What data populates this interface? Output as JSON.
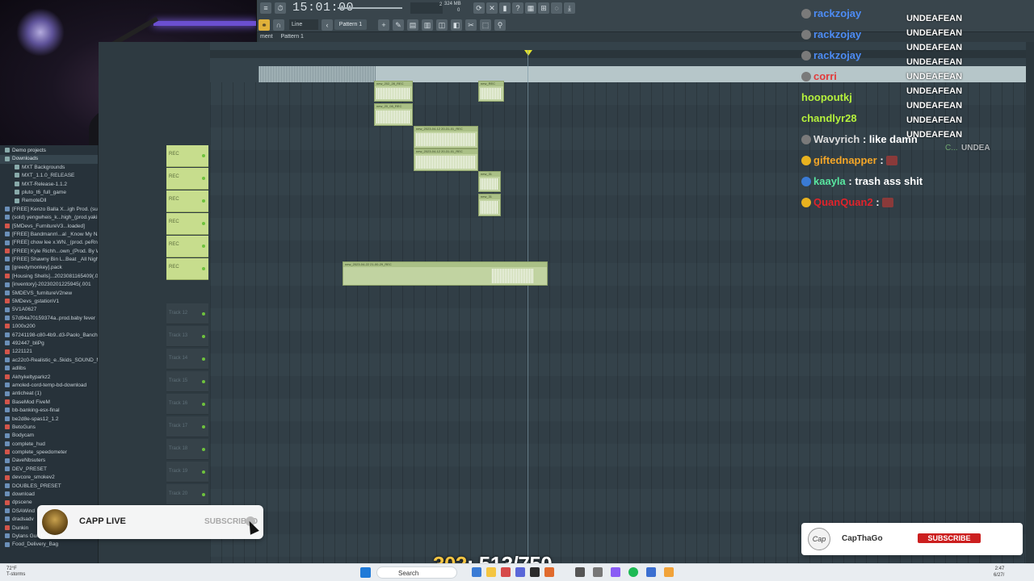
{
  "toolbar": {
    "time": "15:01:00",
    "snap": "Line",
    "pattern": "Pattern 1",
    "cpu": "2",
    "mem": "324 MB",
    "zero": "0"
  },
  "subtabs": {
    "left": "ment",
    "pattern": "Pattern 1"
  },
  "browser": {
    "rows": [
      {
        "label": "Demo projects",
        "type": "folder"
      },
      {
        "label": "Downloads",
        "type": "folder",
        "selected": true
      },
      {
        "label": "MXT Backgrounds",
        "type": "subfolder"
      },
      {
        "label": "MXT_1.1.0_RELEASE",
        "type": "subfolder"
      },
      {
        "label": "MXT-Release-1.1.2",
        "type": "subfolder"
      },
      {
        "label": "pluto_t6_full_game",
        "type": "subfolder"
      },
      {
        "label": "RemoteDll",
        "type": "subfolder"
      },
      {
        "label": "[FREE] Kenzo Balla X...igh Prod. (suave)",
        "type": "file"
      },
      {
        "label": "(sold) yengwheis_k...high_(prod.yakira)",
        "type": "file"
      },
      {
        "label": "[5MDevs_FurnitureV3...loaded]",
        "type": "file"
      },
      {
        "label": "[FREE] Bandmanrri...al _Know My Name",
        "type": "file"
      },
      {
        "label": "[FREE] chow lee x.WN._(prod. peRnd)",
        "type": "file"
      },
      {
        "label": "[FREE] Kyle Richh...own_(Prod. By War)",
        "type": "file"
      },
      {
        "label": "[FREE] Shawny Bin L..Beat _All Night_",
        "type": "file"
      },
      {
        "label": "[greedymonkey].pack",
        "type": "file"
      },
      {
        "label": "[Housing Shells]...2023081165409(.001",
        "type": "file"
      },
      {
        "label": "[inventory]-20230201225945(.001",
        "type": "file"
      },
      {
        "label": "5MDEVS_furnitureV2new",
        "type": "file"
      },
      {
        "label": "5MDevs_gstationV1",
        "type": "file"
      },
      {
        "label": "5V1A0627",
        "type": "file"
      },
      {
        "label": "57d94a70159374a..prod.baby fever",
        "type": "file"
      },
      {
        "label": "1000x200",
        "type": "file"
      },
      {
        "label": "67241198-c80-4b9..d3-Paolo_Banchero",
        "type": "file"
      },
      {
        "label": "492447_bliPg",
        "type": "file"
      },
      {
        "label": "1221121",
        "type": "file"
      },
      {
        "label": "ac22c0-Realistic_e..5kids_SOUND_MOD",
        "type": "file"
      },
      {
        "label": "adlibs",
        "type": "file"
      },
      {
        "label": "Akhykeltyparkz2",
        "type": "file"
      },
      {
        "label": "amoled-cord-temp-bd-download",
        "type": "file"
      },
      {
        "label": "anticheat (1)",
        "type": "file"
      },
      {
        "label": "BaseMod FiveM",
        "type": "file"
      },
      {
        "label": "bb-banking-esx-final",
        "type": "file"
      },
      {
        "label": "be2d8e-spas12_1.2",
        "type": "file"
      },
      {
        "label": "BetoGuns",
        "type": "file"
      },
      {
        "label": "Bodycam",
        "type": "file"
      },
      {
        "label": "complete_hud",
        "type": "file"
      },
      {
        "label": "complete_speedometer",
        "type": "file"
      },
      {
        "label": "DaveNbsuters",
        "type": "file"
      },
      {
        "label": "DEV_PRESET",
        "type": "file"
      },
      {
        "label": "devcore_smokev2",
        "type": "file"
      },
      {
        "label": "DOUBLES_PRESET",
        "type": "file"
      },
      {
        "label": "download",
        "type": "file"
      },
      {
        "label": "dpscene",
        "type": "file"
      },
      {
        "label": "DSAWind",
        "type": "file"
      },
      {
        "label": "dradsadv",
        "type": "file"
      },
      {
        "label": "Dunkin",
        "type": "file"
      },
      {
        "label": "Dylans Gun Pack V2",
        "type": "file"
      },
      {
        "label": "Food_Delivery_Bag",
        "type": "file"
      }
    ]
  },
  "tracks": {
    "rec_label": "REC",
    "dim_labels": [
      "Track 12",
      "Track 13",
      "Track 14",
      "Track 15",
      "Track 16",
      "Track 17",
      "Track 18",
      "Track 19",
      "Track 20"
    ]
  },
  "clips": [
    {
      "title": "new_202_28_REC"
    },
    {
      "title": "new_20_08_REC"
    },
    {
      "title": "new_2023-04-12 20-31-01_REC"
    },
    {
      "title": "new_2023-04-12 20-31-01_REC"
    },
    {
      "title": "new_REC"
    },
    {
      "title": "new_31"
    },
    {
      "title": "new_31"
    },
    {
      "title": "new_2023-04-22 21-00-29_REC"
    }
  ],
  "chat": {
    "messages": [
      {
        "name": "rackzojay",
        "color": "#4d8cf5",
        "msg": ""
      },
      {
        "name": "rackzojay",
        "color": "#4d8cf5",
        "msg": ""
      },
      {
        "name": "rackzojay",
        "color": "#4d8cf5",
        "msg": ""
      },
      {
        "name": "corri",
        "color": "#e23b3b",
        "msg": ""
      },
      {
        "name": "hoopoutkj",
        "color": "#b6f23c",
        "msg": ""
      },
      {
        "name": "chandlyr28",
        "color": "#b6f23c",
        "msg": ""
      },
      {
        "name": "Wavyrich",
        "color": "#dddddd",
        "msg": " : like damn"
      },
      {
        "name": "giftednapper",
        "color": "#f4a628",
        "msg": " :"
      },
      {
        "name": "kaayla",
        "color": "#59e6a0",
        "msg": " : trash ass shit"
      },
      {
        "name": "QuanQuan2",
        "color": "#e0232b",
        "msg": " :"
      }
    ],
    "repeat_text": "UNDEAFEAN",
    "repeat_text_small": "UNDEA",
    "c_label": "C..."
  },
  "subscribe_left": {
    "channel": "CAPP LIVE",
    "button": "SUBSCRIBED"
  },
  "subscribe_right": {
    "logo": "Cap",
    "channel": "CapThaGo",
    "button": "SUBSCRIBE"
  },
  "counter": {
    "a": "302",
    "b": ": 513/750"
  },
  "taskbar": {
    "weather_temp": "72°F",
    "weather_desc": "T-storms",
    "search": "Search",
    "time": "2:47",
    "date": "6/27/"
  }
}
